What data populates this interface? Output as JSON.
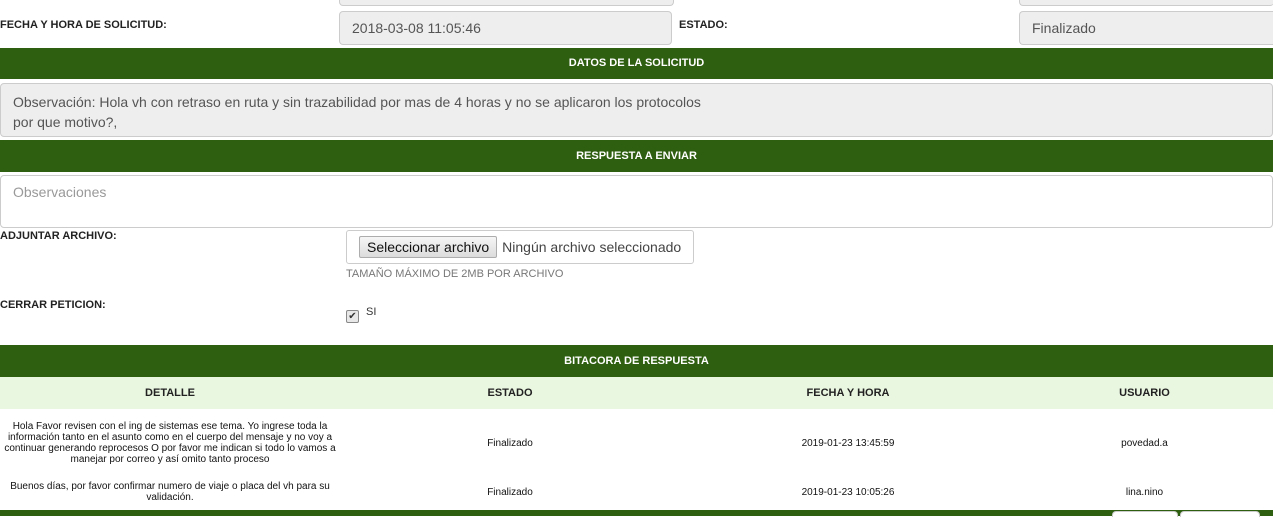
{
  "request": {
    "fecha_label": "FECHA Y HORA DE SOLICITUD:",
    "fecha_value": "2018-03-08 11:05:46",
    "estado_label": "ESTADO:",
    "estado_value": "Finalizado"
  },
  "datos_section": {
    "title": "DATOS DE LA SOLICITUD",
    "observacion_line1": "Observación: Hola vh con retraso en ruta y sin trazabilidad por mas de 4 horas y no se aplicaron los protocolos",
    "observacion_line2": "por que motivo?,"
  },
  "respuesta_section": {
    "title": "RESPUESTA A ENVIAR",
    "observaciones_placeholder": "Observaciones",
    "observaciones_value": "",
    "adjuntar_label": "ADJUNTAR ARCHIVO:",
    "file_button_label": "Seleccionar archivo",
    "file_status": "Ningún archivo seleccionado",
    "file_help": "TAMAÑO MÁXIMO DE 2MB POR ARCHIVO",
    "cerrar_label": "CERRAR PETICION:",
    "cerrar_checked": true,
    "cerrar_option_label": "SI"
  },
  "bitacora": {
    "title": "BITACORA DE RESPUESTA",
    "columns": [
      "DETALLE",
      "ESTADO",
      "FECHA Y HORA",
      "USUARIO"
    ],
    "rows": [
      {
        "detalle": "Hola Favor revisen con el ing de sistemas ese tema. Yo ingrese toda la información tanto en el asunto como en el cuerpo del mensaje y no voy a continuar generando reprocesos O por favor me indican si todo lo vamos a manejar por correo y así omito tanto proceso",
        "estado": "Finalizado",
        "fecha": "2019-01-23 13:45:59",
        "usuario": "povedad.a"
      },
      {
        "detalle": "Buenos días, por favor confirmar numero de viaje o placa del vh para su validación.",
        "estado": "Finalizado",
        "fecha": "2019-01-23 10:05:26",
        "usuario": "lina.nino"
      }
    ]
  },
  "colors": {
    "header_green": "#2e5e0f",
    "table_header_bg": "#eaf7e0",
    "readonly_bg": "#eeeeee"
  }
}
